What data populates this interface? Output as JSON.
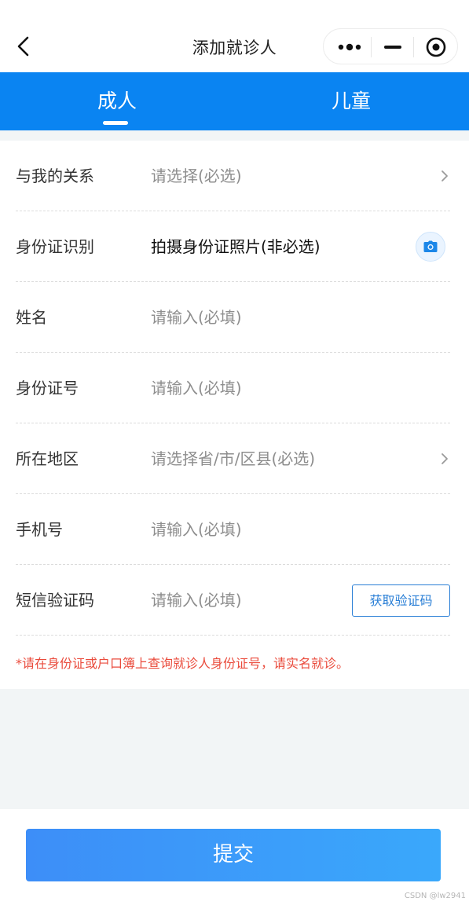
{
  "nav": {
    "title": "添加就诊人",
    "back_icon": "chevron-left-icon",
    "capsule_icons": [
      "more-dots-icon",
      "minimize-icon",
      "target-icon"
    ]
  },
  "tabs": [
    {
      "label": "成人",
      "active": true
    },
    {
      "label": "儿童",
      "active": false
    }
  ],
  "form": {
    "relationship": {
      "label": "与我的关系",
      "placeholder": "请选择(必选)"
    },
    "id_scan": {
      "label": "身份证识别",
      "value": "拍摄身份证照片(非必选)",
      "icon": "camera-icon"
    },
    "name": {
      "label": "姓名",
      "placeholder": "请输入(必填)"
    },
    "id_number": {
      "label": "身份证号",
      "placeholder": "请输入(必填)"
    },
    "region": {
      "label": "所在地区",
      "placeholder": "请选择省/市/区县(必选)"
    },
    "phone": {
      "label": "手机号",
      "placeholder": "请输入(必填)"
    },
    "sms_code": {
      "label": "短信验证码",
      "placeholder": "请输入(必填)",
      "button": "获取验证码"
    },
    "notice": "*请在身份证或户口簿上查询就诊人身份证号，请实名就诊。"
  },
  "footer": {
    "submit_label": "提交"
  },
  "watermark": "CSDN @lw2941",
  "colors": {
    "primary": "#0a84f2",
    "notice": "#ea4b3c",
    "submit_start": "#3d8ef8",
    "submit_end": "#3aa8fb"
  }
}
